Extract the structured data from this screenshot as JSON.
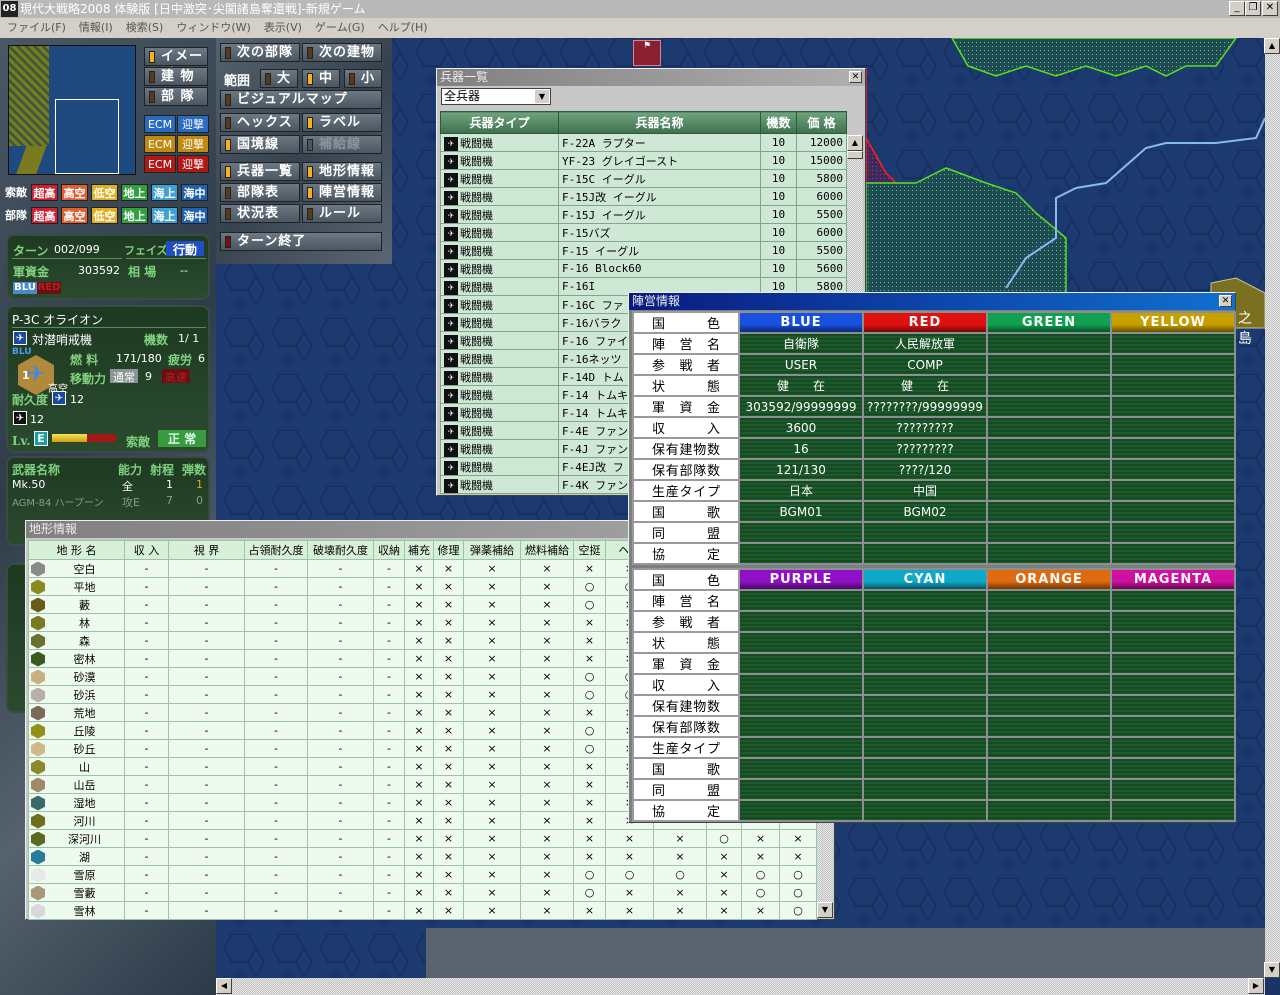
{
  "window": {
    "title": "現代大戦略2008 体験版 [日中激突･尖閣諸島奪還戦]-新規ゲーム",
    "logo": "08",
    "min": "_",
    "restore": "❐",
    "close": "✕"
  },
  "menu": [
    "ファイル(F)",
    "情報(I)",
    "検索(S)",
    "ウィンドウ(W)",
    "表示(V)",
    "ゲーム(G)",
    "ヘルプ(H)"
  ],
  "control": {
    "view_buttons": [
      "イメージ",
      "建 物",
      "部 隊"
    ],
    "ecm": [
      {
        "a": "ECM",
        "b": "迎撃",
        "color": "#2a6ac0"
      },
      {
        "a": "ECM",
        "b": "迎撃",
        "color": "#c08a10"
      },
      {
        "a": "ECM",
        "b": "迎撃",
        "color": "#b01818"
      }
    ],
    "search_label": "索敵",
    "unit_label": "部隊",
    "chips": [
      {
        "t": "超高",
        "c": "#d02030"
      },
      {
        "t": "高空",
        "c": "#e06030"
      },
      {
        "t": "低空",
        "c": "#e0b020"
      },
      {
        "t": "地上",
        "c": "#30a040"
      },
      {
        "t": "海上",
        "c": "#40a0d8"
      },
      {
        "t": "海中",
        "c": "#2060b0"
      }
    ],
    "next_unit": "次の部隊",
    "next_building": "次の建物",
    "range": "範囲",
    "large": "大",
    "medium": "中",
    "small": "小",
    "visual_map": "ビジュアルマップ",
    "hex": "ヘックス",
    "label": "ラベル",
    "border": "国境線",
    "supply": "補給線",
    "weapons_list": "兵器一覧",
    "terrain_info": "地形情報",
    "unit_table": "部隊表",
    "faction_info": "陣営情報",
    "status_table": "状況表",
    "rules": "ルール",
    "end_turn": "ターン終了"
  },
  "status": {
    "turn_label": "ターン",
    "turn": "002/099",
    "phase_label": "フェイズ",
    "phase": "行動",
    "funds_label": "軍資金",
    "funds": "303592",
    "market_label": "相 場",
    "market": "--",
    "blu": "BLU",
    "red": "RED"
  },
  "unit": {
    "name": "P-3C オライオン",
    "type": "対潜哨戒機",
    "count_label": "機数",
    "count": "1/ 1",
    "side": "BLU",
    "stack": "1",
    "altitude": "高空",
    "fuel_label": "燃 料",
    "fuel": "171/180",
    "fatigue_label": "疲労",
    "fatigue": "6",
    "move_label": "移動力",
    "move_mode": "通常",
    "move": "9",
    "fast": "高速",
    "dur_label": "耐久度",
    "dur1": "12",
    "dur2": "12",
    "lv_label": "Lv.",
    "lv": "E",
    "exp_fraction": 0.55,
    "search_label": "索敵",
    "search": "正 常"
  },
  "weapons": {
    "headers": [
      "武器名称",
      "能力",
      "射程",
      "弾数"
    ],
    "rows": [
      [
        "Mk.50",
        "全",
        "1",
        "1"
      ],
      [
        "AGM-84 ハープーン",
        "攻E",
        "7",
        "0"
      ]
    ]
  },
  "weapon_list": {
    "title": "兵器一覧",
    "filter": "全兵器",
    "headers": [
      "兵器タイプ",
      "兵器名称",
      "機数",
      "価 格"
    ],
    "rows": [
      [
        "戦闘機",
        "F-22A ラプター",
        "10",
        "12000"
      ],
      [
        "戦闘機",
        "YF-23 グレイゴースト",
        "10",
        "15000"
      ],
      [
        "戦闘機",
        "F-15C イーグル",
        "10",
        "5800"
      ],
      [
        "戦闘機",
        "F-15J改 イーグル",
        "10",
        "6000"
      ],
      [
        "戦闘機",
        "F-15J イーグル",
        "10",
        "5500"
      ],
      [
        "戦闘機",
        "F-15バズ",
        "10",
        "6000"
      ],
      [
        "戦闘機",
        "F-15 イーグル",
        "10",
        "5500"
      ],
      [
        "戦闘機",
        "F-16 Block60",
        "10",
        "5600"
      ],
      [
        "戦闘機",
        "F-16I",
        "10",
        "5800"
      ],
      [
        "戦闘機",
        "F-16C ファ",
        "",
        ""
      ],
      [
        "戦闘機",
        "F-16バラク",
        "",
        ""
      ],
      [
        "戦闘機",
        "F-16 ファイ",
        "",
        ""
      ],
      [
        "戦闘機",
        "F-16ネッツ",
        "",
        ""
      ],
      [
        "戦闘機",
        "F-14D トム",
        "",
        ""
      ],
      [
        "戦闘機",
        "F-14 トムキ",
        "",
        ""
      ],
      [
        "戦闘機",
        "F-14 トムキ",
        "",
        ""
      ],
      [
        "戦闘機",
        "F-4E ファン",
        "",
        ""
      ],
      [
        "戦闘機",
        "F-4J ファン",
        "",
        ""
      ],
      [
        "戦闘機",
        "F-4EJ改 フ",
        "",
        ""
      ],
      [
        "戦闘機",
        "F-4K ファン",
        "",
        ""
      ]
    ]
  },
  "faction": {
    "title": "陣営情報",
    "labels": [
      "国 色",
      "陣 営 名",
      "参 戦 者",
      "状 態",
      "軍 資 金",
      "収 入",
      "保有建物数",
      "保有部隊数",
      "生産タイプ",
      "国 歌",
      "同 盟",
      "協 定"
    ],
    "top": [
      {
        "name": "BLUE",
        "color": "#1850e0",
        "values": [
          "自衛隊",
          "USER",
          "健　　在",
          "303592/99999999",
          "3600",
          "16",
          "121/130",
          "日本",
          "BGM01",
          "",
          ""
        ]
      },
      {
        "name": "RED",
        "color": "#e01010",
        "values": [
          "人民解放軍",
          "COMP",
          "健　　在",
          "????????/99999999",
          "?????????",
          "?????????",
          "????/120",
          "中国",
          "BGM02",
          "",
          ""
        ]
      },
      {
        "name": "GREEN",
        "color": "#10a050",
        "values": [
          "",
          "",
          "",
          "",
          "",
          "",
          "",
          "",
          "",
          "",
          ""
        ]
      },
      {
        "name": "YELLOW",
        "color": "#c8a000",
        "values": [
          "",
          "",
          "",
          "",
          "",
          "",
          "",
          "",
          "",
          "",
          ""
        ]
      }
    ],
    "bottom": [
      {
        "name": "PURPLE",
        "color": "#9010c8"
      },
      {
        "name": "CYAN",
        "color": "#10a8c8"
      },
      {
        "name": "ORANGE",
        "color": "#e06a10"
      },
      {
        "name": "MAGENTA",
        "color": "#d010a0"
      }
    ]
  },
  "terrain": {
    "title": "地形情報",
    "headers": [
      "地 形 名",
      "収 入",
      "視 界",
      "占領耐久度",
      "破壊耐久度",
      "収納",
      "補充",
      "修理",
      "弾薬補給",
      "燃料補給",
      "空挺",
      "ヘリ"
    ],
    "rows": [
      {
        "n": "空白",
        "c": "#8a8a8a",
        "v": [
          "-",
          "-",
          "-",
          "-",
          "-",
          "×",
          "×",
          "×",
          "×",
          "×",
          "×",
          "",
          "",
          "",
          ""
        ]
      },
      {
        "n": "平地",
        "c": "#8a8a20",
        "v": [
          "-",
          "-",
          "-",
          "-",
          "-",
          "×",
          "×",
          "×",
          "×",
          "○",
          "○",
          "",
          "",
          "",
          ""
        ]
      },
      {
        "n": "藪",
        "c": "#6a5a18",
        "v": [
          "-",
          "-",
          "-",
          "-",
          "-",
          "×",
          "×",
          "×",
          "×",
          "○",
          "×",
          "",
          "",
          "",
          ""
        ]
      },
      {
        "n": "林",
        "c": "#7a7a20",
        "v": [
          "-",
          "-",
          "-",
          "-",
          "-",
          "×",
          "×",
          "×",
          "×",
          "×",
          "×",
          "",
          "",
          "",
          ""
        ]
      },
      {
        "n": "森",
        "c": "#6a7030",
        "v": [
          "-",
          "-",
          "-",
          "-",
          "-",
          "×",
          "×",
          "×",
          "×",
          "×",
          "×",
          "",
          "",
          "",
          ""
        ]
      },
      {
        "n": "密林",
        "c": "#3a5a20",
        "v": [
          "-",
          "-",
          "-",
          "-",
          "-",
          "×",
          "×",
          "×",
          "×",
          "×",
          "×",
          "",
          "",
          "",
          ""
        ]
      },
      {
        "n": "砂漠",
        "c": "#c8b080",
        "v": [
          "-",
          "-",
          "-",
          "-",
          "-",
          "×",
          "×",
          "×",
          "×",
          "○",
          "○",
          "",
          "",
          "",
          ""
        ]
      },
      {
        "n": "砂浜",
        "c": "#b8b0a8",
        "v": [
          "-",
          "-",
          "-",
          "-",
          "-",
          "×",
          "×",
          "×",
          "×",
          "○",
          "○",
          "",
          "",
          "",
          ""
        ]
      },
      {
        "n": "荒地",
        "c": "#7a6a58",
        "v": [
          "-",
          "-",
          "-",
          "-",
          "-",
          "×",
          "×",
          "×",
          "×",
          "×",
          "×",
          "",
          "",
          "",
          ""
        ]
      },
      {
        "n": "丘陵",
        "c": "#90901a",
        "v": [
          "-",
          "-",
          "-",
          "-",
          "-",
          "×",
          "×",
          "×",
          "×",
          "○",
          "×",
          "",
          "",
          "",
          ""
        ]
      },
      {
        "n": "砂丘",
        "c": "#d0b888",
        "v": [
          "-",
          "-",
          "-",
          "-",
          "-",
          "×",
          "×",
          "×",
          "×",
          "○",
          "×",
          "",
          "",
          "",
          ""
        ]
      },
      {
        "n": "山",
        "c": "#8a8a28",
        "v": [
          "-",
          "-",
          "-",
          "-",
          "-",
          "×",
          "×",
          "×",
          "×",
          "×",
          "×",
          "",
          "",
          "",
          ""
        ]
      },
      {
        "n": "山岳",
        "c": "#a08868",
        "v": [
          "-",
          "-",
          "-",
          "-",
          "-",
          "×",
          "×",
          "×",
          "×",
          "×",
          "×",
          "",
          "",
          "",
          ""
        ]
      },
      {
        "n": "湿地",
        "c": "#3a6a6a",
        "v": [
          "-",
          "-",
          "-",
          "-",
          "-",
          "×",
          "×",
          "×",
          "×",
          "×",
          "×",
          "",
          "",
          "",
          ""
        ]
      },
      {
        "n": "河川",
        "c": "#6a7020",
        "v": [
          "-",
          "-",
          "-",
          "-",
          "-",
          "×",
          "×",
          "×",
          "×",
          "×",
          "×",
          "",
          "",
          "",
          ""
        ]
      },
      {
        "n": "深河川",
        "c": "#5a6a20",
        "v": [
          "-",
          "-",
          "-",
          "-",
          "-",
          "×",
          "×",
          "×",
          "×",
          "×",
          "×",
          "×",
          "○",
          "×",
          "×"
        ]
      },
      {
        "n": "湖",
        "c": "#2a7aa0",
        "v": [
          "-",
          "-",
          "-",
          "-",
          "-",
          "×",
          "×",
          "×",
          "×",
          "×",
          "×",
          "×",
          "×",
          "×",
          "×"
        ]
      },
      {
        "n": "雪原",
        "c": "#e8e8e8",
        "v": [
          "-",
          "-",
          "-",
          "-",
          "-",
          "×",
          "×",
          "×",
          "×",
          "○",
          "○",
          "○",
          "×",
          "○",
          "○"
        ]
      },
      {
        "n": "雪藪",
        "c": "#a89878",
        "v": [
          "-",
          "-",
          "-",
          "-",
          "-",
          "×",
          "×",
          "×",
          "×",
          "○",
          "×",
          "×",
          "×",
          "○",
          "○"
        ]
      },
      {
        "n": "雪林",
        "c": "#d8d8d8",
        "v": [
          "-",
          "-",
          "-",
          "-",
          "-",
          "×",
          "×",
          "×",
          "×",
          "×",
          "×",
          "×",
          "×",
          "×",
          "○"
        ]
      }
    ]
  },
  "map": {
    "place_label": "之島"
  }
}
